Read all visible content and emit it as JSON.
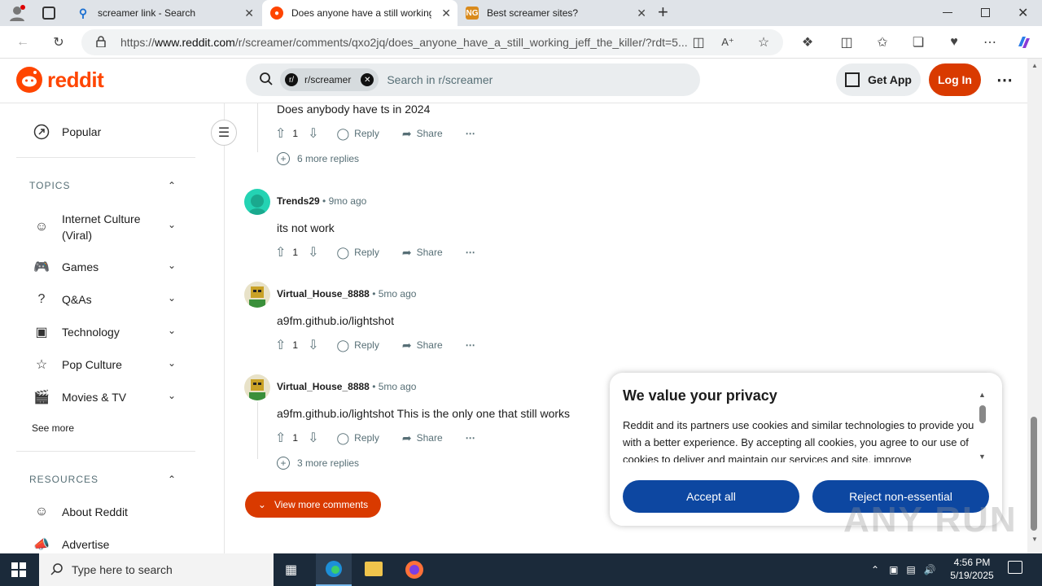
{
  "browser": {
    "tabs": [
      {
        "title": "screamer link - Search",
        "favicon": "bing-search-icon"
      },
      {
        "title": "Does anyone have a still working",
        "favicon": "reddit-icon",
        "active": true
      },
      {
        "title": "Best screamer sites?",
        "favicon": "ng-icon"
      }
    ],
    "new_tab": "+",
    "url_prefix": "https://",
    "url_domain": "www.reddit.com",
    "url_rest": "/r/screamer/comments/qxo2jq/does_anyone_have_a_still_working_jeff_the_killer/?rdt=5..."
  },
  "reddit": {
    "logo_text": "reddit",
    "search_chip": "r/screamer",
    "search_placeholder": "Search in r/screamer",
    "get_app": "Get App",
    "login": "Log In"
  },
  "sidebar": {
    "popular": "Popular",
    "topics_title": "TOPICS",
    "topics": [
      {
        "label": "Internet Culture (Viral)"
      },
      {
        "label": "Games"
      },
      {
        "label": "Q&As"
      },
      {
        "label": "Technology"
      },
      {
        "label": "Pop Culture"
      },
      {
        "label": "Movies & TV"
      }
    ],
    "see_more": "See more",
    "resources_title": "RESOURCES",
    "resources": [
      {
        "label": "About Reddit"
      },
      {
        "label": "Advertise"
      }
    ]
  },
  "comments": {
    "top_body": "Does anybody have ts in 2024",
    "top_votes": "1",
    "top_more": "6 more replies",
    "items": [
      {
        "author": "Trends29",
        "age": "9mo ago",
        "body": "its not work",
        "votes": "1"
      },
      {
        "author": "Virtual_House_8888",
        "age": "5mo ago",
        "body": "a9fm.github.io/lightshot",
        "votes": "1"
      },
      {
        "author": "Virtual_House_8888",
        "age": "5mo ago",
        "body": "a9fm.github.io/lightshot This is the only one that still works",
        "votes": "1"
      }
    ],
    "last_more": "3 more replies",
    "reply": "Reply",
    "share": "Share",
    "view_more": "View more comments"
  },
  "privacy": {
    "title": "We value your privacy",
    "text": "Reddit and its partners use cookies and similar technologies to provide you with a better experience. By accepting all cookies, you agree to our use of cookies to deliver and maintain our services and site, improve",
    "accept": "Accept all",
    "reject": "Reject non-essential"
  },
  "watermark": "ANY RUN",
  "taskbar": {
    "search_placeholder": "Type here to search",
    "time": "4:56 PM",
    "date": "5/19/2025"
  },
  "colors": {
    "reddit_orange": "#d93a00",
    "privacy_blue": "#0d47a1",
    "taskbar": "#1b2a3a"
  }
}
